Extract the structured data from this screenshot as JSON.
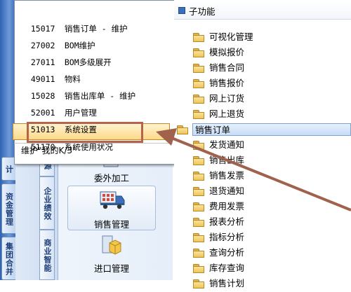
{
  "side_tabs": [
    "计",
    "资金管理",
    "集团合并"
  ],
  "sub_tabs": [
    "源",
    "企业绩效",
    "商业智能"
  ],
  "modules": [
    {
      "label": "委外加工",
      "icon": "outsourcing-icon"
    },
    {
      "label": "销售管理",
      "icon": "delivery-truck-icon"
    },
    {
      "label": "进口管理",
      "icon": "import-box-icon"
    }
  ],
  "popup": {
    "items": [
      {
        "code": "15017",
        "name": "销售订单 - 维护"
      },
      {
        "code": "27002",
        "name": "BOM维护"
      },
      {
        "code": "27011",
        "name": "BOM多级展开"
      },
      {
        "code": "49011",
        "name": "物料"
      },
      {
        "code": "15028",
        "name": "销售出库单 - 维护"
      },
      {
        "code": "52001",
        "name": "用户管理"
      },
      {
        "code": "51013",
        "name": "系统设置"
      },
      {
        "code": "51170",
        "name": "系统使用状况"
      }
    ],
    "maintain_label": "维护\"我的K/3\""
  },
  "tree": {
    "header": "子功能",
    "items": [
      "可视化管理",
      "模拟报价",
      "销售合同",
      "销售报价",
      "网上订货",
      "网上退货",
      "销售订单",
      "发货通知",
      "销售出库",
      "销售发票",
      "退货通知",
      "费用发票",
      "报表分析",
      "指标分析",
      "查询分析",
      "库存查询",
      "销售计划"
    ],
    "selected": "销售订单"
  },
  "colors": {
    "highlight_border": "#b5634a",
    "arrow": "#a0624c",
    "side_strip": "#2f63b2",
    "folder": "#efc55a"
  }
}
